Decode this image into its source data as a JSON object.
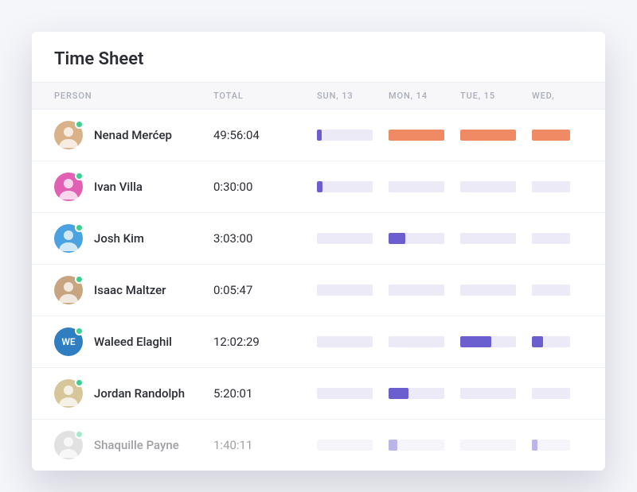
{
  "title": "Time Sheet",
  "columns": {
    "person": "PERSON",
    "total": "TOTAL",
    "days": [
      "SUN, 13",
      "MON, 14",
      "TUE, 15",
      "WED,"
    ]
  },
  "colors": {
    "orange": "#ef8a65",
    "purple": "#6b5ecf",
    "track": "#eceaf7",
    "online": "#3ecf8e"
  },
  "rows": [
    {
      "name": "Nenad Merćep",
      "total": "49:56:04",
      "avatar": {
        "type": "photo",
        "bg": "#d9b28a"
      },
      "online": true,
      "faded": false,
      "bars": [
        {
          "fill": 8,
          "color": "purple"
        },
        {
          "fill": 100,
          "color": "orange"
        },
        {
          "fill": 100,
          "color": "orange"
        },
        {
          "fill": 100,
          "color": "orange"
        }
      ]
    },
    {
      "name": "Ivan Villa",
      "total": "0:30:00",
      "avatar": {
        "type": "photo",
        "bg": "#e160b3"
      },
      "online": true,
      "faded": false,
      "bars": [
        {
          "fill": 10,
          "color": "purple"
        },
        {
          "fill": 0,
          "color": "purple"
        },
        {
          "fill": 0,
          "color": "purple"
        },
        {
          "fill": 0,
          "color": "purple"
        }
      ]
    },
    {
      "name": "Josh Kim",
      "total": "3:03:00",
      "avatar": {
        "type": "photo",
        "bg": "#4aa3e0"
      },
      "online": true,
      "faded": false,
      "bars": [
        {
          "fill": 0,
          "color": "purple"
        },
        {
          "fill": 30,
          "color": "purple"
        },
        {
          "fill": 0,
          "color": "purple"
        },
        {
          "fill": 0,
          "color": "purple"
        }
      ]
    },
    {
      "name": "Isaac Maltzer",
      "total": "0:05:47",
      "avatar": {
        "type": "photo",
        "bg": "#c8a581"
      },
      "online": true,
      "faded": false,
      "bars": [
        {
          "fill": 0,
          "color": "purple"
        },
        {
          "fill": 0,
          "color": "purple"
        },
        {
          "fill": 0,
          "color": "purple"
        },
        {
          "fill": 0,
          "color": "purple"
        }
      ]
    },
    {
      "name": "Waleed Elaghil",
      "total": "12:02:29",
      "avatar": {
        "type": "initials",
        "initials": "WE",
        "bg": "#2f7ec2"
      },
      "online": true,
      "faded": false,
      "bars": [
        {
          "fill": 0,
          "color": "purple"
        },
        {
          "fill": 0,
          "color": "purple"
        },
        {
          "fill": 55,
          "color": "purple"
        },
        {
          "fill": 30,
          "color": "purple"
        }
      ]
    },
    {
      "name": "Jordan Randolph",
      "total": "5:20:01",
      "avatar": {
        "type": "photo",
        "bg": "#d8c69b"
      },
      "online": true,
      "faded": false,
      "bars": [
        {
          "fill": 0,
          "color": "purple"
        },
        {
          "fill": 35,
          "color": "purple"
        },
        {
          "fill": 0,
          "color": "purple"
        },
        {
          "fill": 0,
          "color": "purple"
        }
      ]
    },
    {
      "name": "Shaquille Payne",
      "total": "1:40:11",
      "avatar": {
        "type": "photo",
        "bg": "#bdbdbd"
      },
      "online": true,
      "faded": true,
      "bars": [
        {
          "fill": 0,
          "color": "purple"
        },
        {
          "fill": 15,
          "color": "purple"
        },
        {
          "fill": 0,
          "color": "purple"
        },
        {
          "fill": 15,
          "color": "purple"
        }
      ]
    }
  ]
}
